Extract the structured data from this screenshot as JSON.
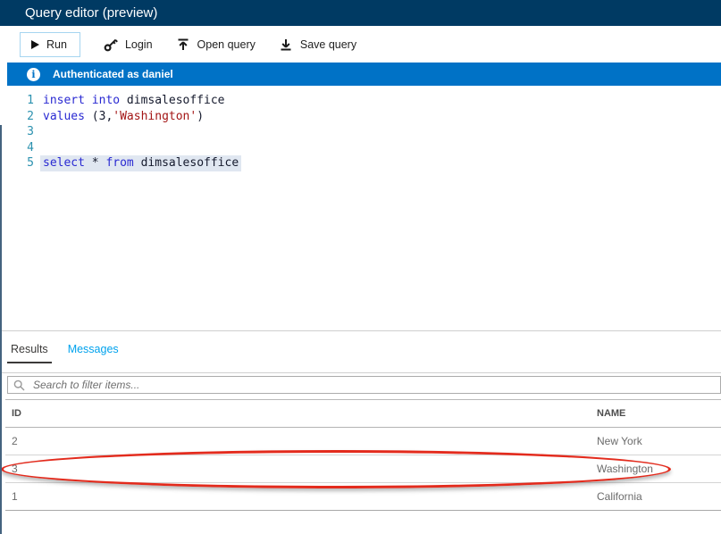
{
  "header": {
    "title": "Query editor (preview)"
  },
  "toolbar": {
    "run_label": "Run",
    "login_label": "Login",
    "open_query_label": "Open query",
    "save_query_label": "Save query"
  },
  "infobar": {
    "text": "Authenticated as daniel"
  },
  "editor": {
    "lines": [
      {
        "num": "1",
        "selected": false,
        "tokens": [
          {
            "t": "kw",
            "v": "insert into"
          },
          {
            "t": "id",
            "v": " dimsalesoffice"
          }
        ]
      },
      {
        "num": "2",
        "selected": false,
        "tokens": [
          {
            "t": "kw",
            "v": "values"
          },
          {
            "t": "id",
            "v": " (3,"
          },
          {
            "t": "str",
            "v": "'Washington'"
          },
          {
            "t": "id",
            "v": ")"
          }
        ]
      },
      {
        "num": "3",
        "selected": false,
        "tokens": []
      },
      {
        "num": "4",
        "selected": false,
        "tokens": []
      },
      {
        "num": "5",
        "selected": true,
        "tokens": [
          {
            "t": "kw",
            "v": "select"
          },
          {
            "t": "id",
            "v": " * "
          },
          {
            "t": "kw",
            "v": "from"
          },
          {
            "t": "id",
            "v": " dimsalesoffice"
          }
        ]
      }
    ]
  },
  "tabs": {
    "results": "Results",
    "messages": "Messages"
  },
  "search": {
    "placeholder": "Search to filter items..."
  },
  "table": {
    "columns": [
      "ID",
      "NAME"
    ],
    "rows": [
      {
        "id": "2",
        "name": "New York",
        "annotated": false
      },
      {
        "id": "3",
        "name": "Washington",
        "annotated": true
      },
      {
        "id": "1",
        "name": "California",
        "annotated": false
      }
    ]
  },
  "annotation": {
    "type": "red-ellipse",
    "circled_row": "Washington"
  },
  "colors": {
    "header_bg": "#003a63",
    "info_bg": "#0072c6",
    "messages_tab": "#00a2ed",
    "keyword": "#2929d2",
    "string": "#a31515",
    "line_number": "#2b91af",
    "selection_bg": "#e0e7f1",
    "annotation_red": "#e32b1d",
    "run_border": "#a6d5f0"
  }
}
